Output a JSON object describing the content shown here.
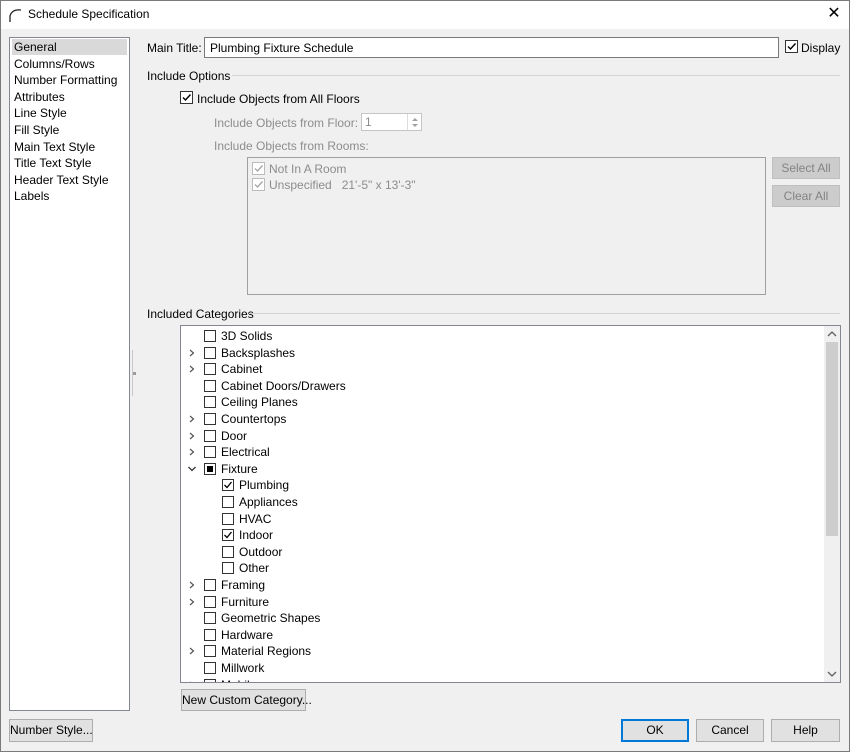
{
  "window": {
    "title": "Schedule Specification",
    "close_glyph": "✕"
  },
  "sidebar": {
    "items": [
      {
        "label": "General",
        "selected": true
      },
      {
        "label": "Columns/Rows"
      },
      {
        "label": "Number Formatting"
      },
      {
        "label": "Attributes"
      },
      {
        "label": "Line Style"
      },
      {
        "label": "Fill Style"
      },
      {
        "label": "Main Text Style"
      },
      {
        "label": "Title Text Style"
      },
      {
        "label": "Header Text Style"
      },
      {
        "label": "Labels"
      }
    ]
  },
  "general": {
    "main_title_label": "Main Title:",
    "main_title_value": "Plumbing Fixture Schedule",
    "display_label": "Display",
    "display_checked": true,
    "include_options_heading": "Include Options",
    "all_floors_label": "Include Objects from All Floors",
    "all_floors_checked": true,
    "from_floor_label": "Include Objects from Floor:",
    "from_floor_value": "1",
    "from_rooms_label": "Include Objects from Rooms:",
    "rooms": [
      {
        "label": "Not In A Room",
        "checked": true
      },
      {
        "label": "Unspecified   21'-5\" x 13'-3\"",
        "checked": true
      }
    ],
    "select_all_label": "Select All",
    "clear_all_label": "Clear All",
    "included_categories_heading": "Included Categories",
    "new_custom_category_label": "New Custom Category..."
  },
  "categories": [
    {
      "label": "3D Solids",
      "level": 0,
      "expander": "none",
      "state": "unchecked"
    },
    {
      "label": "Backsplashes",
      "level": 0,
      "expander": "collapsed",
      "state": "unchecked"
    },
    {
      "label": "Cabinet",
      "level": 0,
      "expander": "collapsed",
      "state": "unchecked"
    },
    {
      "label": "Cabinet Doors/Drawers",
      "level": 0,
      "expander": "none",
      "state": "unchecked"
    },
    {
      "label": "Ceiling Planes",
      "level": 0,
      "expander": "none",
      "state": "unchecked"
    },
    {
      "label": "Countertops",
      "level": 0,
      "expander": "collapsed",
      "state": "unchecked"
    },
    {
      "label": "Door",
      "level": 0,
      "expander": "collapsed",
      "state": "unchecked"
    },
    {
      "label": "Electrical",
      "level": 0,
      "expander": "collapsed",
      "state": "unchecked"
    },
    {
      "label": "Fixture",
      "level": 0,
      "expander": "expanded",
      "state": "partial"
    },
    {
      "label": "Plumbing",
      "level": 1,
      "expander": "none",
      "state": "checked"
    },
    {
      "label": "Appliances",
      "level": 1,
      "expander": "none",
      "state": "unchecked"
    },
    {
      "label": "HVAC",
      "level": 1,
      "expander": "none",
      "state": "unchecked"
    },
    {
      "label": "Indoor",
      "level": 1,
      "expander": "none",
      "state": "checked"
    },
    {
      "label": "Outdoor",
      "level": 1,
      "expander": "none",
      "state": "unchecked"
    },
    {
      "label": "Other",
      "level": 1,
      "expander": "none",
      "state": "unchecked"
    },
    {
      "label": "Framing",
      "level": 0,
      "expander": "collapsed",
      "state": "unchecked"
    },
    {
      "label": "Furniture",
      "level": 0,
      "expander": "collapsed",
      "state": "unchecked"
    },
    {
      "label": "Geometric Shapes",
      "level": 0,
      "expander": "none",
      "state": "unchecked"
    },
    {
      "label": "Hardware",
      "level": 0,
      "expander": "none",
      "state": "unchecked"
    },
    {
      "label": "Material Regions",
      "level": 0,
      "expander": "collapsed",
      "state": "unchecked"
    },
    {
      "label": "Millwork",
      "level": 0,
      "expander": "none",
      "state": "unchecked"
    },
    {
      "label": "Mobile",
      "level": 0,
      "expander": "collapsed",
      "state": "unchecked"
    }
  ],
  "footer": {
    "number_style_label": "Number Style...",
    "ok_label": "OK",
    "cancel_label": "Cancel",
    "help_label": "Help"
  }
}
